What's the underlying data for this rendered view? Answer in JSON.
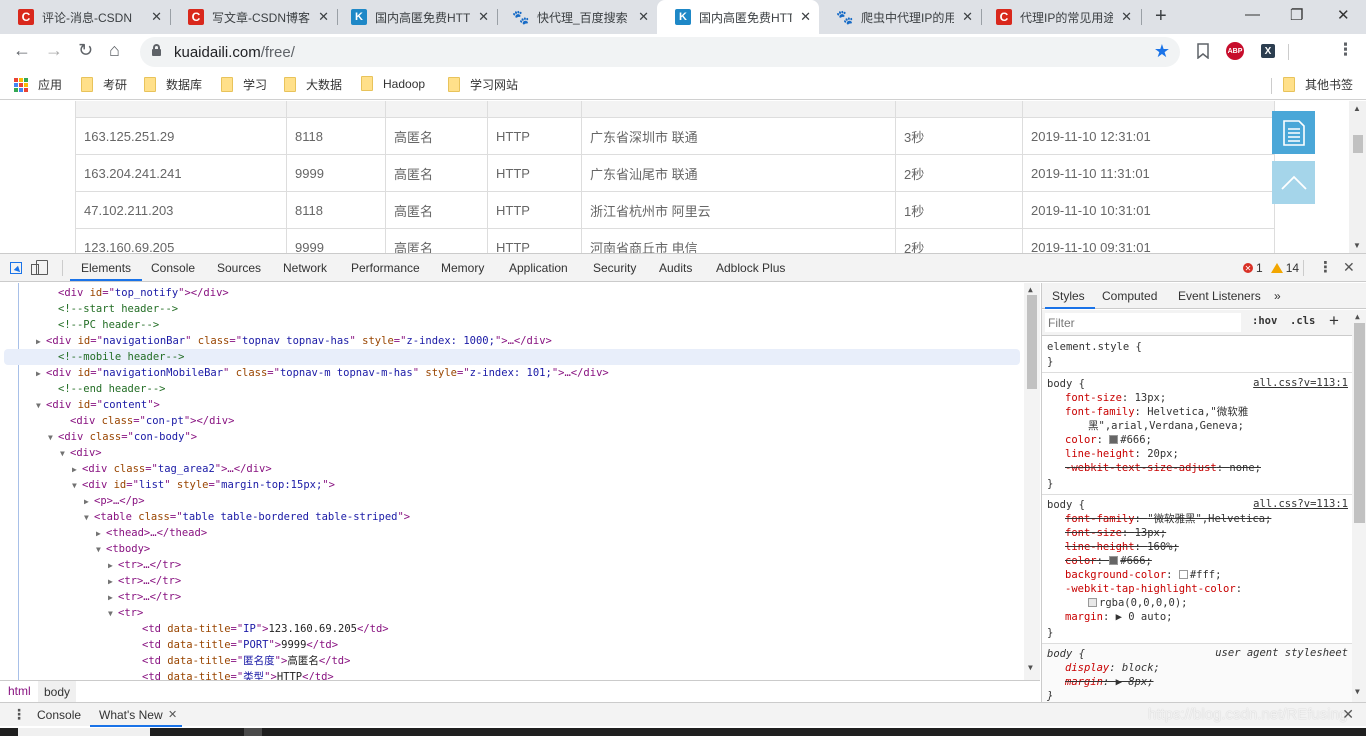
{
  "browser": {
    "tabs": [
      {
        "favicon": "csdn",
        "title": "评论-消息-CSDN",
        "active": false
      },
      {
        "favicon": "csdn",
        "title": "写文章-CSDN博客",
        "active": false
      },
      {
        "favicon": "kuaidaili",
        "title": "国内高匿免费HTTP",
        "active": false
      },
      {
        "favicon": "baidu",
        "title": "快代理_百度搜索",
        "active": false
      },
      {
        "favicon": "kuaidaili",
        "title": "国内高匿免费HTTP",
        "active": true
      },
      {
        "favicon": "baidu",
        "title": "爬虫中代理IP的用途",
        "active": false
      },
      {
        "favicon": "csdn",
        "title": "代理IP的常见用途",
        "active": false
      }
    ],
    "tab_close_glyph": "✕",
    "new_tab_glyph": "+",
    "window_controls": {
      "minimize": "—",
      "restore": "❐",
      "close": "✕"
    },
    "nav": {
      "back": "←",
      "forward": "→",
      "reload": "↻",
      "home": "⌂"
    },
    "url": {
      "host": "kuaidaili.com",
      "path": "/free/"
    },
    "star_glyph": "★",
    "extensions": {
      "abp": "ABP",
      "x": "X"
    },
    "menu_glyph": "⋮",
    "bookmarks": {
      "apps_label": "应用",
      "folders": [
        "考研",
        "数据库",
        "学习",
        "大数据",
        "Hadoop",
        "学习网站"
      ],
      "other_label": "其他书签"
    }
  },
  "page": {
    "table_rows": [
      {
        "ip": "163.125.251.29",
        "port": "8118",
        "anonymity": "高匿名",
        "type": "HTTP",
        "location": "广东省深圳市 联通",
        "speed": "3秒",
        "last_verified": "2019-11-10 12:31:01"
      },
      {
        "ip": "163.204.241.241",
        "port": "9999",
        "anonymity": "高匿名",
        "type": "HTTP",
        "location": "广东省汕尾市 联通",
        "speed": "2秒",
        "last_verified": "2019-11-10 11:31:01"
      },
      {
        "ip": "47.102.211.203",
        "port": "8118",
        "anonymity": "高匿名",
        "type": "HTTP",
        "location": "浙江省杭州市 阿里云",
        "speed": "1秒",
        "last_verified": "2019-11-10 10:31:01"
      },
      {
        "ip": "123.160.69.205",
        "port": "9999",
        "anonymity": "高匿名",
        "type": "HTTP",
        "location": "河南省商丘市 电信",
        "speed": "2秒",
        "last_verified": "2019-11-10 09:31:01"
      }
    ]
  },
  "devtools": {
    "tabs": [
      "Elements",
      "Console",
      "Sources",
      "Network",
      "Performance",
      "Memory",
      "Application",
      "Security",
      "Audits",
      "Adblock Plus"
    ],
    "active_tab": "Elements",
    "errors": "1",
    "warnings": "14",
    "dom_lines": [
      {
        "indent": 4,
        "tri": "",
        "html": "<span class=\"tag\">&lt;div </span><span class=\"attr\">id</span><span class=\"tag\">=\"</span><span class=\"val\">top_notify</span><span class=\"tag\">\"&gt;&lt;/div&gt;</span>"
      },
      {
        "indent": 4,
        "tri": "",
        "html": "<span class=\"cmt\">&lt;!--start header--&gt;</span>"
      },
      {
        "indent": 4,
        "tri": "",
        "html": "<span class=\"cmt\">&lt;!--PC header--&gt;</span>"
      },
      {
        "indent": 3,
        "tri": "▶",
        "html": "<span class=\"tag\">&lt;div </span><span class=\"attr\">id</span><span class=\"tag\">=\"</span><span class=\"val\">navigationBar</span><span class=\"tag\">\" </span><span class=\"attr\">class</span><span class=\"tag\">=\"</span><span class=\"val\">topnav topnav-has</span><span class=\"tag\">\" </span><span class=\"attr\">style</span><span class=\"tag\">=\"</span><span class=\"val\">z-index: 1000;</span><span class=\"tag\">\"&gt;…&lt;/div&gt;</span>"
      },
      {
        "indent": 4,
        "tri": "",
        "html": "<span class=\"cmt\">&lt;!--mobile header--&gt;</span>",
        "selected": true
      },
      {
        "indent": 3,
        "tri": "▶",
        "html": "<span class=\"tag\">&lt;div </span><span class=\"attr\">id</span><span class=\"tag\">=\"</span><span class=\"val\">navigationMobileBar</span><span class=\"tag\">\" </span><span class=\"attr\">class</span><span class=\"tag\">=\"</span><span class=\"val\">topnav-m topnav-m-has</span><span class=\"tag\">\" </span><span class=\"attr\">style</span><span class=\"tag\">=\"</span><span class=\"val\">z-index: 101;</span><span class=\"tag\">\"&gt;…&lt;/div&gt;</span>"
      },
      {
        "indent": 4,
        "tri": "",
        "html": "<span class=\"cmt\">&lt;!--end header--&gt;</span>"
      },
      {
        "indent": 3,
        "tri": "▼",
        "html": "<span class=\"tag\">&lt;div </span><span class=\"attr\">id</span><span class=\"tag\">=\"</span><span class=\"val\">content</span><span class=\"tag\">\"&gt;</span>"
      },
      {
        "indent": 5,
        "tri": "",
        "html": "<span class=\"tag\">&lt;div </span><span class=\"attr\">class</span><span class=\"tag\">=\"</span><span class=\"val\">con-pt</span><span class=\"tag\">\"&gt;&lt;/div&gt;</span>"
      },
      {
        "indent": 4,
        "tri": "▼",
        "html": "<span class=\"tag\">&lt;div </span><span class=\"attr\">class</span><span class=\"tag\">=\"</span><span class=\"val\">con-body</span><span class=\"tag\">\"&gt;</span>"
      },
      {
        "indent": 5,
        "tri": "▼",
        "html": "<span class=\"tag\">&lt;div&gt;</span>"
      },
      {
        "indent": 6,
        "tri": "▶",
        "html": "<span class=\"tag\">&lt;div </span><span class=\"attr\">class</span><span class=\"tag\">=\"</span><span class=\"val\">tag_area2</span><span class=\"tag\">\"&gt;…&lt;/div&gt;</span>"
      },
      {
        "indent": 6,
        "tri": "▼",
        "html": "<span class=\"tag\">&lt;div </span><span class=\"attr\">id</span><span class=\"tag\">=\"</span><span class=\"val\">list</span><span class=\"tag\">\" </span><span class=\"attr\">style</span><span class=\"tag\">=\"</span><span class=\"val\">margin-top:15px;</span><span class=\"tag\">\"&gt;</span>"
      },
      {
        "indent": 7,
        "tri": "▶",
        "html": "<span class=\"tag\">&lt;p&gt;…&lt;/p&gt;</span>"
      },
      {
        "indent": 7,
        "tri": "▼",
        "html": "<span class=\"tag\">&lt;table </span><span class=\"attr\">class</span><span class=\"tag\">=\"</span><span class=\"val\">table table-bordered table-striped</span><span class=\"tag\">\"&gt;</span>"
      },
      {
        "indent": 8,
        "tri": "▶",
        "html": "<span class=\"tag\">&lt;thead&gt;…&lt;/thead&gt;</span>"
      },
      {
        "indent": 8,
        "tri": "▼",
        "html": "<span class=\"tag\">&lt;tbody&gt;</span>"
      },
      {
        "indent": 9,
        "tri": "▶",
        "html": "<span class=\"tag\">&lt;tr&gt;…&lt;/tr&gt;</span>"
      },
      {
        "indent": 9,
        "tri": "▶",
        "html": "<span class=\"tag\">&lt;tr&gt;…&lt;/tr&gt;</span>"
      },
      {
        "indent": 9,
        "tri": "▶",
        "html": "<span class=\"tag\">&lt;tr&gt;…&lt;/tr&gt;</span>"
      },
      {
        "indent": 9,
        "tri": "▼",
        "html": "<span class=\"tag\">&lt;tr&gt;</span>"
      },
      {
        "indent": 11,
        "tri": "",
        "html": "<span class=\"tag\">&lt;td </span><span class=\"attr\">data-title</span><span class=\"tag\">=\"</span><span class=\"val\">IP</span><span class=\"tag\">\"&gt;</span><span class=\"txt\">123.160.69.205</span><span class=\"tag\">&lt;/td&gt;</span>"
      },
      {
        "indent": 11,
        "tri": "",
        "html": "<span class=\"tag\">&lt;td </span><span class=\"attr\">data-title</span><span class=\"tag\">=\"</span><span class=\"val\">PORT</span><span class=\"tag\">\"&gt;</span><span class=\"txt\">9999</span><span class=\"tag\">&lt;/td&gt;</span>"
      },
      {
        "indent": 11,
        "tri": "",
        "html": "<span class=\"tag\">&lt;td </span><span class=\"attr\">data-title</span><span class=\"tag\">=\"</span><span class=\"val\">匿名度</span><span class=\"tag\">\"&gt;</span><span class=\"txt\">高匿名</span><span class=\"tag\">&lt;/td&gt;</span>"
      },
      {
        "indent": 11,
        "tri": "",
        "html": "<span class=\"tag\">&lt;td </span><span class=\"attr\">data-title</span><span class=\"tag\">=\"</span><span class=\"val\">类型</span><span class=\"tag\">\"&gt;</span><span class=\"txt\">HTTP</span><span class=\"tag\">&lt;/td&gt;</span>"
      }
    ],
    "breadcrumbs": [
      "html",
      "body"
    ],
    "styles": {
      "tabs": [
        "Styles",
        "Computed",
        "Event Listeners",
        "»"
      ],
      "filter_placeholder": "Filter",
      "hov": ":hov",
      "cls": ".cls",
      "add": "+",
      "element_style": "element.style {",
      "close_brace": "}",
      "rule1": {
        "selector": "body {",
        "source": "all.css?v=113:1",
        "lines": [
          {
            "prop": "font-size",
            "value": "13px;"
          },
          {
            "prop": "font-family",
            "value": "Helvetica,\"微软雅"
          },
          {
            "prop": "",
            "value": "黑\",arial,Verdana,Geneva;"
          },
          {
            "prop": "color",
            "value": "#666;",
            "swatch": "#666666"
          },
          {
            "prop": "line-height",
            "value": "20px;"
          },
          {
            "prop": "-webkit-text-size-adjust",
            "value": "none;",
            "strike": true
          }
        ]
      },
      "rule2": {
        "selector": "body {",
        "source": "all.css?v=113:1",
        "lines": [
          {
            "prop": "font-family",
            "value": "\"微软雅黑\",Helvetica;",
            "strike": true
          },
          {
            "prop": "font-size",
            "value": "13px;",
            "strike": true
          },
          {
            "prop": "line-height",
            "value": "160%;",
            "strike": true
          },
          {
            "prop": "color",
            "value": "#666;",
            "strike": true,
            "swatch": "#666666"
          },
          {
            "prop": "background-color",
            "value": "#fff;",
            "swatch": "#ffffff"
          },
          {
            "prop": "-webkit-tap-highlight-color",
            "value": ""
          },
          {
            "prop": "",
            "value": "rgba(0,0,0,0);",
            "swatch": "#e8e8e8"
          },
          {
            "prop": "margin",
            "value": "▶ 0 auto;"
          }
        ]
      },
      "rule3": {
        "selector": "body {",
        "source": "user agent stylesheet",
        "lines": [
          {
            "prop": "display",
            "value": "block;"
          },
          {
            "prop": "margin",
            "value": "▶ 8px;",
            "strike": true
          }
        ]
      }
    },
    "drawer": {
      "tabs": [
        "Console",
        "What's New"
      ],
      "active": "What's New",
      "close_glyph": "✕"
    }
  },
  "watermark": "https://blog.csdn.net/REfusing"
}
